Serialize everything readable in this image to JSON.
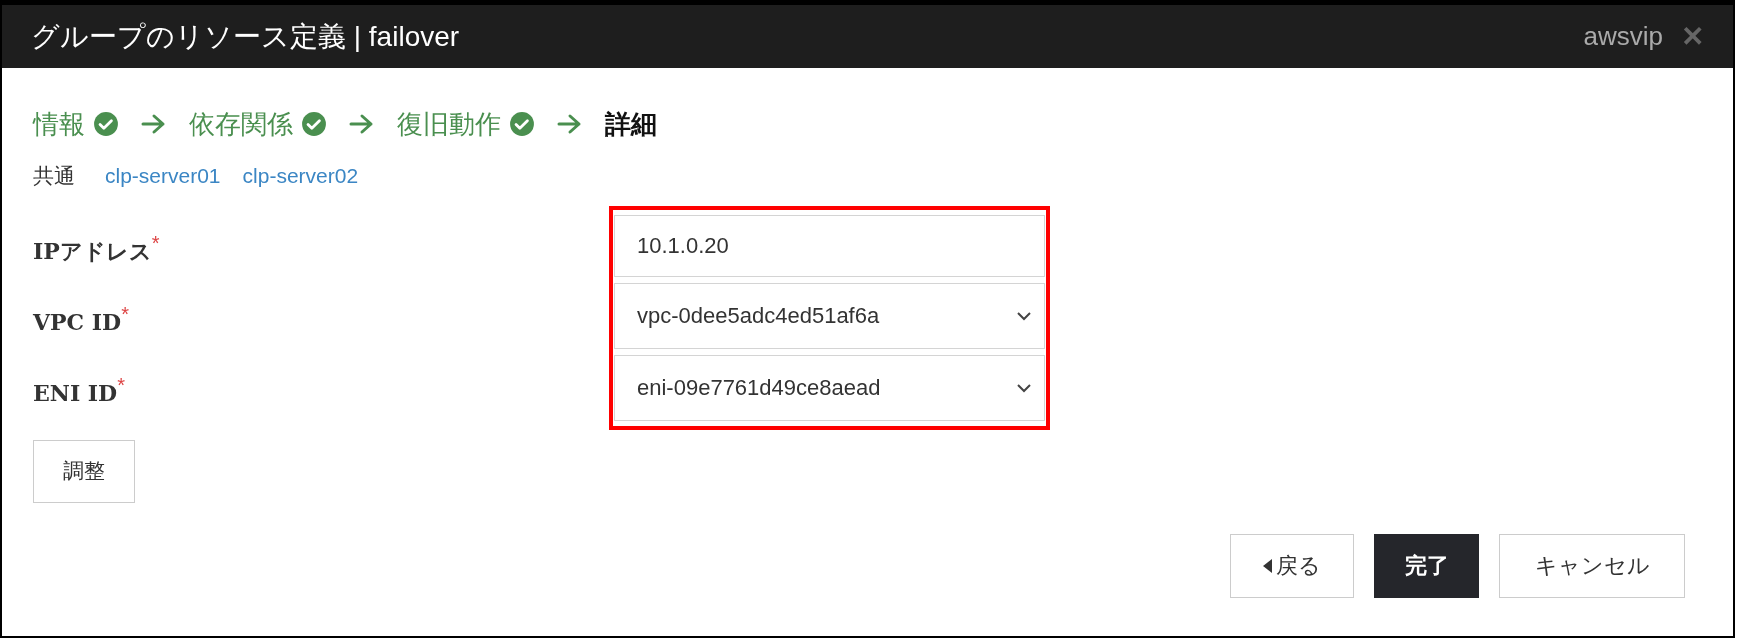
{
  "window": {
    "title": "グループのリソース定義 | failover",
    "resource_name": "awsvip",
    "close": "✕"
  },
  "steps": [
    {
      "label": "情報",
      "done": true,
      "current": false
    },
    {
      "label": "依存関係",
      "done": true,
      "current": false
    },
    {
      "label": "復旧動作",
      "done": true,
      "current": false
    },
    {
      "label": "詳細",
      "done": false,
      "current": true
    }
  ],
  "server_tabs": [
    {
      "label": "共通",
      "selected": true
    },
    {
      "label": "clp-server01",
      "selected": false
    },
    {
      "label": "clp-server02",
      "selected": false
    }
  ],
  "fields": [
    {
      "label": "IPアドレス",
      "required": "*",
      "kind": "text",
      "value": "10.1.0.20"
    },
    {
      "label": "VPC ID",
      "required": "*",
      "kind": "select",
      "value": "vpc-0dee5adc4ed51af6a"
    },
    {
      "label": "ENI ID",
      "required": "*",
      "kind": "select",
      "value": "eni-09e7761d49ce8aead"
    }
  ],
  "adjust_button": "調整",
  "buttons": [
    {
      "label": "戻る",
      "kind": "back"
    },
    {
      "label": "完了",
      "kind": "primary"
    },
    {
      "label": "キャンセル",
      "kind": "normal"
    }
  ]
}
